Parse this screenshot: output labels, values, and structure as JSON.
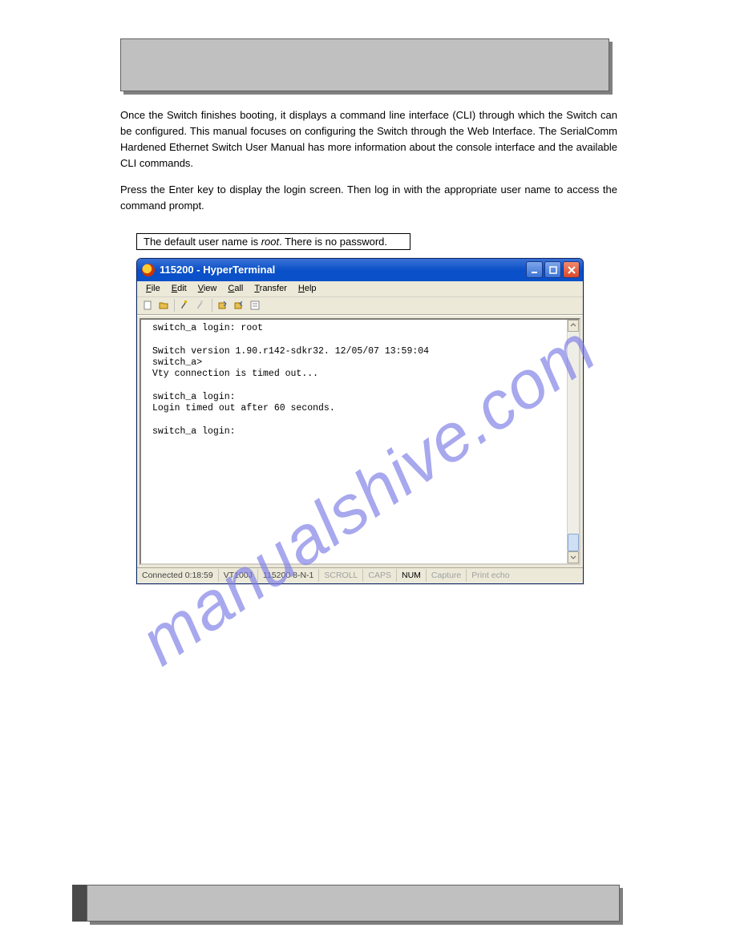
{
  "page": {
    "paragraph1": "Once the Switch finishes booting, it displays a command line interface (CLI) through which the Switch can be configured. This manual focuses on configuring the Switch through the Web Interface. The SerialComm Hardened Ethernet Switch User Manual has more information about the console interface and the available CLI commands.",
    "paragraph2": "Press the Enter key to display the login screen. Then log in with the appropriate user name to access the command prompt."
  },
  "note": {
    "prefix": "The default user name is ",
    "value": "root",
    "suffix": ". There is no password."
  },
  "hyperterminal": {
    "title": "115200 - HyperTerminal",
    "menus": [
      "File",
      "Edit",
      "View",
      "Call",
      "Transfer",
      "Help"
    ],
    "terminal_lines": [
      "switch_a login: root",
      "",
      "Switch version 1.90.r142-sdkr32. 12/05/07 13:59:04",
      "switch_a>",
      "Vty connection is timed out...",
      "",
      "switch_a login:",
      "Login timed out after 60 seconds.",
      "",
      "switch_a login:"
    ],
    "status": {
      "connected": "Connected 0:18:59",
      "emulation": "VT100J",
      "settings": "115200 8-N-1",
      "scroll": "SCROLL",
      "caps": "CAPS",
      "num": "NUM",
      "capture": "Capture",
      "printecho": "Print echo"
    }
  },
  "toolbar_icons": {
    "new": "new-file-icon",
    "open": "open-folder-icon",
    "connect": "connect-icon",
    "disconnect": "disconnect-icon",
    "send": "send-icon",
    "receive": "receive-icon",
    "properties": "properties-icon"
  },
  "watermark": "manualshive.com"
}
